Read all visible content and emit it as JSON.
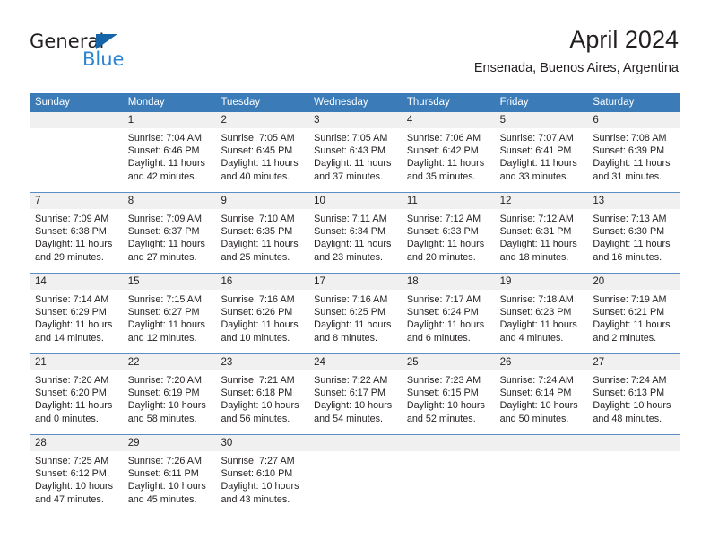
{
  "logo": {
    "text_primary": "General",
    "text_secondary": "Blue",
    "primary_color": "#231f20",
    "secondary_color": "#2a85d0",
    "triangle_color": "#1565a8"
  },
  "header": {
    "title": "April 2024",
    "subtitle": "Ensenada, Buenos Aires, Argentina"
  },
  "theme": {
    "header_bg": "#3b7cb8",
    "header_text": "#ffffff",
    "date_band_bg": "#f0f0f0",
    "week_divider": "#5b8fc4",
    "body_text": "#231f20"
  },
  "weekdays": [
    "Sunday",
    "Monday",
    "Tuesday",
    "Wednesday",
    "Thursday",
    "Friday",
    "Saturday"
  ],
  "weeks": [
    {
      "dates": [
        "",
        "1",
        "2",
        "3",
        "4",
        "5",
        "6"
      ],
      "cells": [
        {
          "lines": []
        },
        {
          "lines": [
            "Sunrise: 7:04 AM",
            "Sunset: 6:46 PM",
            "Daylight: 11 hours",
            "and 42 minutes."
          ]
        },
        {
          "lines": [
            "Sunrise: 7:05 AM",
            "Sunset: 6:45 PM",
            "Daylight: 11 hours",
            "and 40 minutes."
          ]
        },
        {
          "lines": [
            "Sunrise: 7:05 AM",
            "Sunset: 6:43 PM",
            "Daylight: 11 hours",
            "and 37 minutes."
          ]
        },
        {
          "lines": [
            "Sunrise: 7:06 AM",
            "Sunset: 6:42 PM",
            "Daylight: 11 hours",
            "and 35 minutes."
          ]
        },
        {
          "lines": [
            "Sunrise: 7:07 AM",
            "Sunset: 6:41 PM",
            "Daylight: 11 hours",
            "and 33 minutes."
          ]
        },
        {
          "lines": [
            "Sunrise: 7:08 AM",
            "Sunset: 6:39 PM",
            "Daylight: 11 hours",
            "and 31 minutes."
          ]
        }
      ]
    },
    {
      "dates": [
        "7",
        "8",
        "9",
        "10",
        "11",
        "12",
        "13"
      ],
      "cells": [
        {
          "lines": [
            "Sunrise: 7:09 AM",
            "Sunset: 6:38 PM",
            "Daylight: 11 hours",
            "and 29 minutes."
          ]
        },
        {
          "lines": [
            "Sunrise: 7:09 AM",
            "Sunset: 6:37 PM",
            "Daylight: 11 hours",
            "and 27 minutes."
          ]
        },
        {
          "lines": [
            "Sunrise: 7:10 AM",
            "Sunset: 6:35 PM",
            "Daylight: 11 hours",
            "and 25 minutes."
          ]
        },
        {
          "lines": [
            "Sunrise: 7:11 AM",
            "Sunset: 6:34 PM",
            "Daylight: 11 hours",
            "and 23 minutes."
          ]
        },
        {
          "lines": [
            "Sunrise: 7:12 AM",
            "Sunset: 6:33 PM",
            "Daylight: 11 hours",
            "and 20 minutes."
          ]
        },
        {
          "lines": [
            "Sunrise: 7:12 AM",
            "Sunset: 6:31 PM",
            "Daylight: 11 hours",
            "and 18 minutes."
          ]
        },
        {
          "lines": [
            "Sunrise: 7:13 AM",
            "Sunset: 6:30 PM",
            "Daylight: 11 hours",
            "and 16 minutes."
          ]
        }
      ]
    },
    {
      "dates": [
        "14",
        "15",
        "16",
        "17",
        "18",
        "19",
        "20"
      ],
      "cells": [
        {
          "lines": [
            "Sunrise: 7:14 AM",
            "Sunset: 6:29 PM",
            "Daylight: 11 hours",
            "and 14 minutes."
          ]
        },
        {
          "lines": [
            "Sunrise: 7:15 AM",
            "Sunset: 6:27 PM",
            "Daylight: 11 hours",
            "and 12 minutes."
          ]
        },
        {
          "lines": [
            "Sunrise: 7:16 AM",
            "Sunset: 6:26 PM",
            "Daylight: 11 hours",
            "and 10 minutes."
          ]
        },
        {
          "lines": [
            "Sunrise: 7:16 AM",
            "Sunset: 6:25 PM",
            "Daylight: 11 hours",
            "and 8 minutes."
          ]
        },
        {
          "lines": [
            "Sunrise: 7:17 AM",
            "Sunset: 6:24 PM",
            "Daylight: 11 hours",
            "and 6 minutes."
          ]
        },
        {
          "lines": [
            "Sunrise: 7:18 AM",
            "Sunset: 6:23 PM",
            "Daylight: 11 hours",
            "and 4 minutes."
          ]
        },
        {
          "lines": [
            "Sunrise: 7:19 AM",
            "Sunset: 6:21 PM",
            "Daylight: 11 hours",
            "and 2 minutes."
          ]
        }
      ]
    },
    {
      "dates": [
        "21",
        "22",
        "23",
        "24",
        "25",
        "26",
        "27"
      ],
      "cells": [
        {
          "lines": [
            "Sunrise: 7:20 AM",
            "Sunset: 6:20 PM",
            "Daylight: 11 hours",
            "and 0 minutes."
          ]
        },
        {
          "lines": [
            "Sunrise: 7:20 AM",
            "Sunset: 6:19 PM",
            "Daylight: 10 hours",
            "and 58 minutes."
          ]
        },
        {
          "lines": [
            "Sunrise: 7:21 AM",
            "Sunset: 6:18 PM",
            "Daylight: 10 hours",
            "and 56 minutes."
          ]
        },
        {
          "lines": [
            "Sunrise: 7:22 AM",
            "Sunset: 6:17 PM",
            "Daylight: 10 hours",
            "and 54 minutes."
          ]
        },
        {
          "lines": [
            "Sunrise: 7:23 AM",
            "Sunset: 6:15 PM",
            "Daylight: 10 hours",
            "and 52 minutes."
          ]
        },
        {
          "lines": [
            "Sunrise: 7:24 AM",
            "Sunset: 6:14 PM",
            "Daylight: 10 hours",
            "and 50 minutes."
          ]
        },
        {
          "lines": [
            "Sunrise: 7:24 AM",
            "Sunset: 6:13 PM",
            "Daylight: 10 hours",
            "and 48 minutes."
          ]
        }
      ]
    },
    {
      "dates": [
        "28",
        "29",
        "30",
        "",
        "",
        "",
        ""
      ],
      "cells": [
        {
          "lines": [
            "Sunrise: 7:25 AM",
            "Sunset: 6:12 PM",
            "Daylight: 10 hours",
            "and 47 minutes."
          ]
        },
        {
          "lines": [
            "Sunrise: 7:26 AM",
            "Sunset: 6:11 PM",
            "Daylight: 10 hours",
            "and 45 minutes."
          ]
        },
        {
          "lines": [
            "Sunrise: 7:27 AM",
            "Sunset: 6:10 PM",
            "Daylight: 10 hours",
            "and 43 minutes."
          ]
        },
        {
          "lines": []
        },
        {
          "lines": []
        },
        {
          "lines": []
        },
        {
          "lines": []
        }
      ]
    }
  ]
}
